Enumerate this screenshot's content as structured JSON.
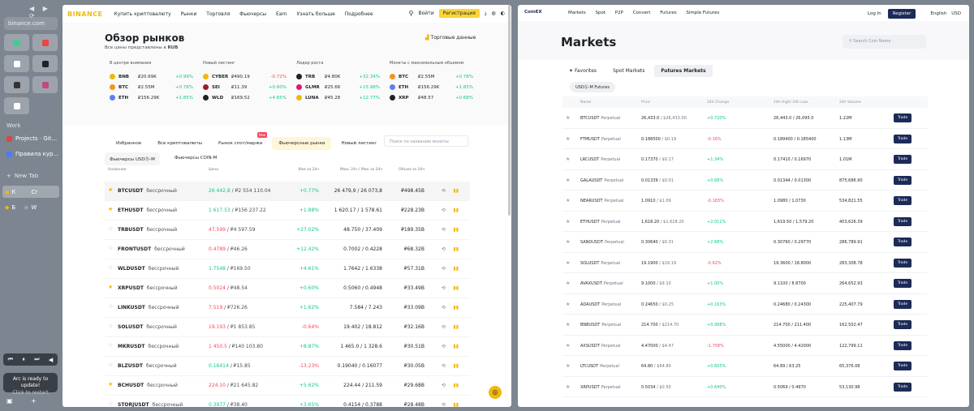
{
  "sidebar": {
    "url": "binance.com",
    "work_label": "Work",
    "tabs": [
      "Projects · Git...",
      "Правила кур..."
    ],
    "new_tab": "New Tab",
    "pinned": [
      {
        "a": "К",
        "b": "Cr"
      },
      {
        "a": "Б",
        "b": "W"
      }
    ],
    "update_title": "Arc is ready to update!",
    "update_sub": "Click to restart"
  },
  "binance": {
    "logo": "BINANCE",
    "menu": [
      "Купить криптовалюту",
      "Рынки",
      "Торговля",
      "Фьючерсы",
      "Earn",
      "Узнать больше",
      "Подробнее"
    ],
    "login": "Войти",
    "register": "Регистрация",
    "title": "Обзор рынков",
    "subtitle": "Все цены представлены в",
    "currency": "RUB",
    "trade_data": "Торговые данные",
    "cards": [
      {
        "title": "В центре внимания",
        "rows": [
          {
            "sym": "BNB",
            "price": "₽20.69K",
            "chg": "+0.99%",
            "color": "#f0b90b",
            "up": true
          },
          {
            "sym": "BTC",
            "price": "₽2.55M",
            "chg": "+0.78%",
            "color": "#f7931a",
            "up": true
          },
          {
            "sym": "ETH",
            "price": "₽156.29K",
            "chg": "+1.85%",
            "color": "#627eea",
            "up": true
          }
        ]
      },
      {
        "title": "Новый листинг",
        "rows": [
          {
            "sym": "CYBER",
            "price": "₽490.19",
            "chg": "-0.72%",
            "color": "#f0b90b",
            "up": false
          },
          {
            "sym": "SEI",
            "price": "₽11.39",
            "chg": "+0.60%",
            "color": "#9b1c2e",
            "up": true
          },
          {
            "sym": "WLD",
            "price": "₽169.52",
            "chg": "+4.65%",
            "color": "#1e2329",
            "up": true
          }
        ]
      },
      {
        "title": "Лидер роста",
        "rows": [
          {
            "sym": "TRB",
            "price": "₽4.80K",
            "chg": "+32.34%",
            "color": "#1e2329",
            "up": true
          },
          {
            "sym": "GLMR",
            "price": "₽25.66",
            "chg": "+15.98%",
            "color": "#e1147b",
            "up": true
          },
          {
            "sym": "LUNA",
            "price": "₽45.28",
            "chg": "+12.77%",
            "color": "#f0b90b",
            "up": true
          }
        ]
      },
      {
        "title": "Монеты с максимальным объемом",
        "rows": [
          {
            "sym": "BTC",
            "price": "₽2.55M",
            "chg": "+0.78%",
            "color": "#f7931a",
            "up": true
          },
          {
            "sym": "ETH",
            "price": "₽156.29K",
            "chg": "+1.85%",
            "color": "#627eea",
            "up": true
          },
          {
            "sym": "XRP",
            "price": "₽48.57",
            "chg": "+0.68%",
            "color": "#1e2329",
            "up": true
          }
        ]
      }
    ],
    "tabs": [
      "Избранное",
      "Все криптовалюты",
      "Рынок спот/маржи",
      "Фьючерсные рынки",
      "Новый листинг"
    ],
    "new_badge": "New",
    "search_placeholder": "Поиск по названию монеты",
    "subtabs": [
      "Фьючерсы USDⓈ-M",
      "Фьючерсы COIN-M"
    ],
    "columns": [
      "Название",
      "Цена",
      "Изм за 24ч",
      "Макс 24ч / Мин за 24ч",
      "Объем за 24ч"
    ],
    "suffix": "бессрочный",
    "rows": [
      {
        "sym": "BTCUSDT",
        "price": "26 442,8",
        "fiat": "₽2 554 110.04",
        "chg": "+0.77%",
        "hl": "26 479,9 / 26 073,8",
        "vol": "₽498.45B",
        "fav": true,
        "up": true
      },
      {
        "sym": "ETHUSDT",
        "price": "1 617.53",
        "fiat": "₽156 237.22",
        "chg": "+1.88%",
        "hl": "1 620.17 / 1 578.61",
        "vol": "₽228.23B",
        "fav": true,
        "up": true
      },
      {
        "sym": "TRBUSDT",
        "price": "47.599",
        "fiat": "₽4 597.59",
        "chg": "+27.02%",
        "hl": "48.750 / 37.409",
        "vol": "₽189.35B",
        "fav": false,
        "up": false
      },
      {
        "sym": "FRONTUSDT",
        "price": "0.4789",
        "fiat": "₽46.26",
        "chg": "+12.42%",
        "hl": "0.7002 / 0.4228",
        "vol": "₽68.32B",
        "fav": false,
        "up": false
      },
      {
        "sym": "WLDUSDT",
        "price": "1.7548",
        "fiat": "₽169.50",
        "chg": "+4.61%",
        "hl": "1.7642 / 1.6338",
        "vol": "₽57.31B",
        "fav": false,
        "up": true
      },
      {
        "sym": "XRPUSDT",
        "price": "0.5024",
        "fiat": "₽48.54",
        "chg": "+0.60%",
        "hl": "0.5060 / 0.4948",
        "vol": "₽33.49B",
        "fav": true,
        "up": false
      },
      {
        "sym": "LINKUSDT",
        "price": "7.519",
        "fiat": "₽726.26",
        "chg": "+1.62%",
        "hl": "7.584 / 7.243",
        "vol": "₽33.09B",
        "fav": false,
        "up": false
      },
      {
        "sym": "SOLUSDT",
        "price": "19.193",
        "fiat": "₽1 853.85",
        "chg": "-0.64%",
        "hl": "19.402 / 18.812",
        "vol": "₽32.16B",
        "fav": false,
        "up": false
      },
      {
        "sym": "MKRUSDT",
        "price": "1 450.5",
        "fiat": "₽140 103.80",
        "chg": "+8.87%",
        "hl": "1 465.0 / 1 328.6",
        "vol": "₽30.51B",
        "fav": false,
        "up": false
      },
      {
        "sym": "BLZUSDT",
        "price": "0.16414",
        "fiat": "₽15.85",
        "chg": "-13.23%",
        "hl": "0.19040 / 0.16077",
        "vol": "₽30.05B",
        "fav": false,
        "up": true
      },
      {
        "sym": "BCHUSDT",
        "price": "224.10",
        "fiat": "₽21 645.82",
        "chg": "+5.62%",
        "hl": "224.44 / 211.59",
        "vol": "₽29.68B",
        "fav": true,
        "up": false
      },
      {
        "sym": "STORJUSDT",
        "price": "0.3977",
        "fiat": "₽38.40",
        "chg": "+3.65%",
        "hl": "0.4154 / 0.3788",
        "vol": "₽28.48B",
        "fav": false,
        "up": true
      }
    ]
  },
  "coinex": {
    "logo": "CoinEX",
    "menu": [
      "Markets",
      "Spot",
      "P2P",
      "Convert",
      "Futures",
      "Simple Futures"
    ],
    "login": "Log In",
    "register": "Register",
    "lang": "English",
    "fiat": "USD",
    "title": "Markets",
    "search_placeholder": "Search Coin Name",
    "tabs": [
      "Favorites",
      "Spot Markets",
      "Futures Markets"
    ],
    "sub": "USDⓈ-M Futures",
    "columns": [
      "Name",
      "Price",
      "24h Change",
      "24h High/ 24h Low",
      "24h Volume"
    ],
    "suffix": "Perpetual",
    "trade": "Trade",
    "rows": [
      {
        "sym": "BTCUSDT",
        "price": "26,433.0",
        "usd": "$26,433.00",
        "chg": "+0.720%",
        "hl": "26,443.0 / 26,095.0",
        "vol": "1.22M",
        "up": true
      },
      {
        "sym": "FTMUSDT",
        "price": "0.188500",
        "usd": "$0.19",
        "chg": "-0.16%",
        "hl": "0.189400 / 0.185400",
        "vol": "1.13M",
        "up": false
      },
      {
        "sym": "LRCUSDT",
        "price": "0.17370",
        "usd": "$0.17",
        "chg": "+1.34%",
        "hl": "0.17410 / 0.16970",
        "vol": "1.01M",
        "up": true
      },
      {
        "sym": "GALAUSDT",
        "price": "0.01339",
        "usd": "$0.01",
        "chg": "+0.68%",
        "hl": "0.01344 / 0.01300",
        "vol": "875,686.90",
        "up": true
      },
      {
        "sym": "NEARUSDT",
        "price": "1.0910",
        "usd": "$1.09",
        "chg": "-0.183%",
        "hl": "1.0980 / 1.0730",
        "vol": "534,821.55",
        "up": false
      },
      {
        "sym": "ETHUSDT",
        "price": "1,618.20",
        "usd": "$1,618.20",
        "chg": "+2.011%",
        "hl": "1,619.50 / 1,579.20",
        "vol": "403,626.39",
        "up": true
      },
      {
        "sym": "SANDUSDT",
        "price": "0.30640",
        "usd": "$0.31",
        "chg": "+2.68%",
        "hl": "0.30760 / 0.29770",
        "vol": "286,789.91",
        "up": true
      },
      {
        "sym": "SOLUSDT",
        "price": "19.1900",
        "usd": "$19.19",
        "chg": "-0.62%",
        "hl": "19.3600 / 18.8000",
        "vol": "283,308.78",
        "up": false
      },
      {
        "sym": "AVAXUSDT",
        "price": "9.1000",
        "usd": "$9.10",
        "chg": "+1.00%",
        "hl": "9.1100 / 8.8700",
        "vol": "264,652.93",
        "up": true
      },
      {
        "sym": "ADAUSDT",
        "price": "0.24650",
        "usd": "$0.25",
        "chg": "+0.163%",
        "hl": "0.24680 / 0.24300",
        "vol": "225,407.79",
        "up": true
      },
      {
        "sym": "BNBUSDT",
        "price": "214.700",
        "usd": "$214.70",
        "chg": "+0.988%",
        "hl": "214.700 / 211.400",
        "vol": "162,502.47",
        "up": true
      },
      {
        "sym": "AXSUSDT",
        "price": "4.47000",
        "usd": "$4.47",
        "chg": "-1.758%",
        "hl": "4.55000 / 4.42000",
        "vol": "122,799.11",
        "up": false
      },
      {
        "sym": "LTCUSDT",
        "price": "64.80",
        "usd": "$64.80",
        "chg": "+0.605%",
        "hl": "64.89 / 63.25",
        "vol": "65,376.08",
        "up": true
      },
      {
        "sym": "XRPUSDT",
        "price": "0.5034",
        "usd": "$0.50",
        "chg": "+0.640%",
        "hl": "0.5069 / 0.4970",
        "vol": "53,130.98",
        "up": true
      }
    ]
  }
}
